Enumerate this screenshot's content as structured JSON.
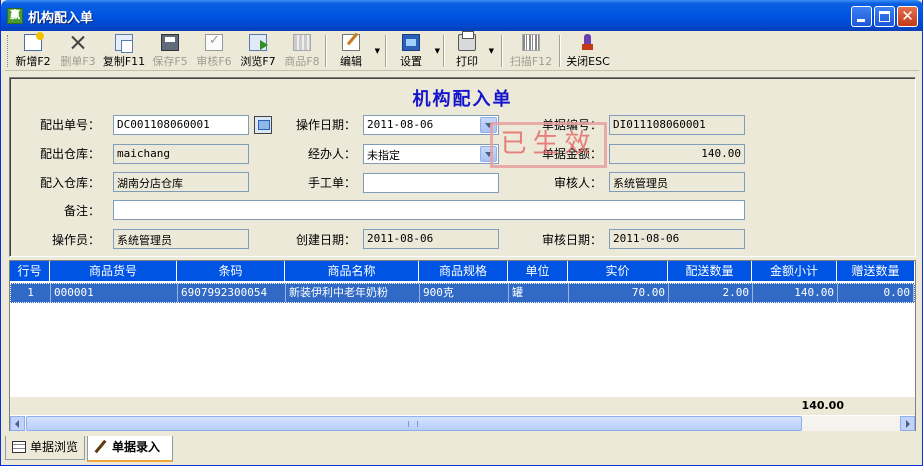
{
  "window": {
    "icon_text": "赢",
    "title": "机构配入单"
  },
  "toolbar": [
    {
      "label": "新增F2",
      "icon": "new-icon",
      "enabled": true
    },
    {
      "label": "删单F3",
      "icon": "delete-icon",
      "enabled": false
    },
    {
      "label": "复制F11",
      "icon": "copy-icon",
      "enabled": true
    },
    {
      "label": "保存F5",
      "icon": "save-icon",
      "enabled": false
    },
    {
      "label": "审核F6",
      "icon": "audit-icon",
      "enabled": false
    },
    {
      "label": "浏览F7",
      "icon": "browse-icon",
      "enabled": true
    },
    {
      "label": "商品F8",
      "icon": "goods-icon",
      "enabled": false
    },
    {
      "label": "编辑",
      "icon": "edit-icon",
      "enabled": true
    },
    {
      "label": "设置",
      "icon": "settings-icon",
      "enabled": true
    },
    {
      "label": "打印",
      "icon": "print-icon",
      "enabled": true
    },
    {
      "label": "扫描F12",
      "icon": "scan-icon",
      "enabled": false
    },
    {
      "label": "关闭ESC",
      "icon": "close-door-icon",
      "enabled": true
    }
  ],
  "form": {
    "title": "机构配入单",
    "out_no_label": "配出单号：",
    "out_no": "DC001108060001",
    "op_date_label": "操作日期：",
    "op_date": "2011-08-06",
    "doc_no_label": "单据编号：",
    "doc_no": "DI011108060001",
    "out_wh_label": "配出仓库：",
    "out_wh": "maichang",
    "handler_label": "经办人：",
    "handler": "未指定",
    "amount_label": "单据金额：",
    "amount": "140.00",
    "in_wh_label": "配入仓库：",
    "in_wh": "湖南分店仓库",
    "manual_no_label": "手工单：",
    "manual_no": "",
    "auditor_label": "审核人：",
    "auditor": "系统管理员",
    "remark_label": "备注：",
    "remark": "",
    "operator_label": "操作员：",
    "operator": "系统管理员",
    "create_date_label": "创建日期：",
    "create_date": "2011-08-06",
    "audit_date_label": "审核日期：",
    "audit_date": "2011-08-06",
    "stamp": "已生效"
  },
  "grid": {
    "headers": [
      "行号",
      "商品货号",
      "条码",
      "商品名称",
      "商品规格",
      "单位",
      "实价",
      "配送数量",
      "金额小计",
      "赠送数量"
    ],
    "rows": [
      [
        "1",
        "000001",
        "6907992300054",
        "新装伊利中老年奶粉",
        "900克",
        "罐",
        "70.00",
        "2.00",
        "140.00",
        "0.00"
      ]
    ],
    "total_amount": "140.00"
  },
  "tabs": [
    {
      "label": "单据浏览",
      "active": false
    },
    {
      "label": "单据录入",
      "active": true
    }
  ]
}
